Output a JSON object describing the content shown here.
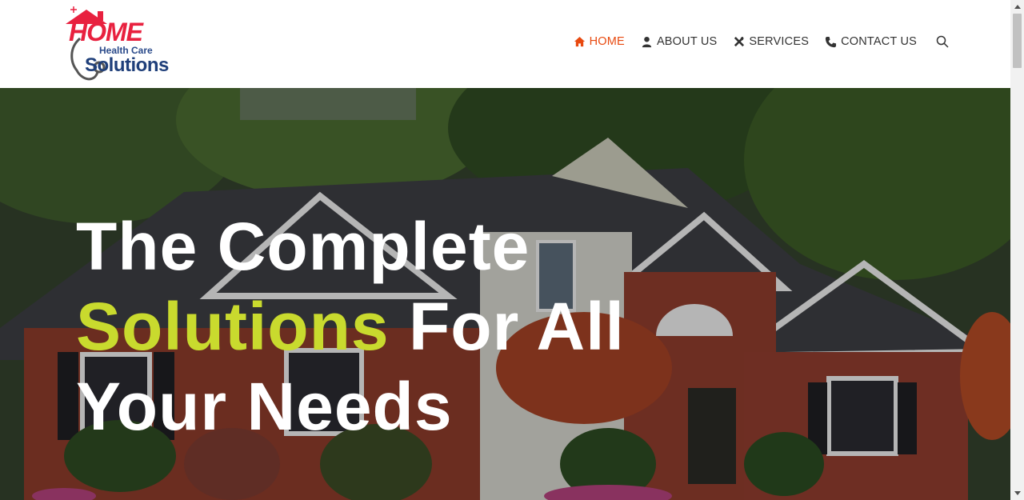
{
  "logo": {
    "line1": "HOME",
    "line2": "Health Care",
    "line3": "Solutions"
  },
  "nav": {
    "items": [
      {
        "label": "HOME",
        "icon": "home-icon",
        "active": true
      },
      {
        "label": "ABOUT US",
        "icon": "user-icon",
        "active": false
      },
      {
        "label": "SERVICES",
        "icon": "tools-icon",
        "active": false
      },
      {
        "label": "CONTACT US",
        "icon": "phone-icon",
        "active": false
      }
    ],
    "search_icon": "search-icon"
  },
  "hero": {
    "line1": "The Complete",
    "accent": "Solutions",
    "line2_rest": " For All",
    "line3": "Your Needs"
  },
  "colors": {
    "accent": "#e8490f",
    "highlight": "#c9da2e",
    "logo_red": "#e8213f",
    "logo_blue": "#1f3f7a"
  }
}
